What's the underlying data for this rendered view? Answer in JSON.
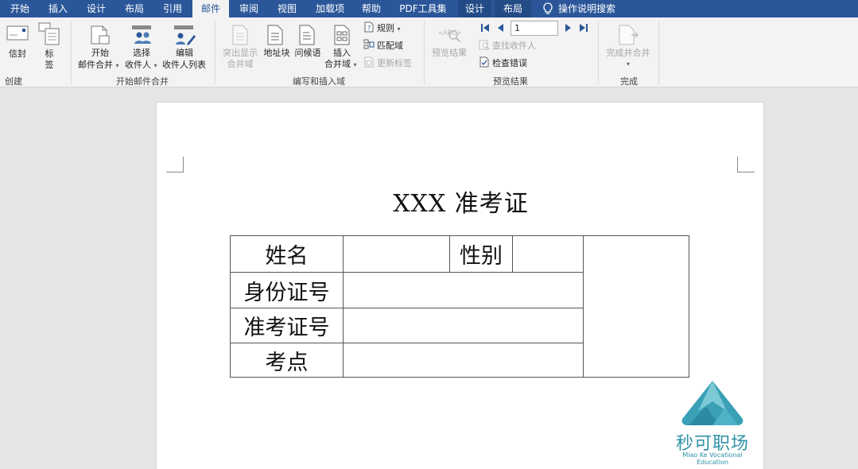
{
  "tabs": [
    {
      "label": "开始",
      "active": false
    },
    {
      "label": "插入",
      "active": false
    },
    {
      "label": "设计",
      "active": false
    },
    {
      "label": "布局",
      "active": false
    },
    {
      "label": "引用",
      "active": false
    },
    {
      "label": "邮件",
      "active": true
    },
    {
      "label": "审阅",
      "active": false
    },
    {
      "label": "视图",
      "active": false
    },
    {
      "label": "加载项",
      "active": false
    },
    {
      "label": "帮助",
      "active": false
    },
    {
      "label": "PDF工具集",
      "active": false
    },
    {
      "label": "设计",
      "active": false
    },
    {
      "label": "布局",
      "active": false
    }
  ],
  "tell_me": "操作说明搜索",
  "ribbon": {
    "create": {
      "envelope": "信封",
      "label_1": "标",
      "label_2": "签",
      "group": "创建"
    },
    "start_merge": {
      "start_1": "开始",
      "start_2": "邮件合并",
      "select_1": "选择",
      "select_2": "收件人",
      "edit_1": "编辑",
      "edit_2": "收件人列表",
      "group": "开始邮件合并"
    },
    "write_insert": {
      "highlight_1": "突出显示",
      "highlight_2": "合并域",
      "address_block": "地址块",
      "greeting": "问候语",
      "insert_1": "插入",
      "insert_2": "合并域",
      "rules": "规则",
      "match_fields": "匹配域",
      "update_labels": "更新标签",
      "group": "编写和插入域"
    },
    "preview": {
      "preview_results": "预览结果",
      "record": "1",
      "find_recipient": "查找收件人",
      "check_errors": "检查错误",
      "group": "预览结果"
    },
    "finish": {
      "finish_merge": "完成并合并",
      "group": "完成"
    }
  },
  "document": {
    "title": "XXX 准考证",
    "table": {
      "name_label": "姓名",
      "gender_label": "性别",
      "id_label": "身份证号",
      "ticket_label": "准考证号",
      "site_label": "考点"
    }
  },
  "watermark": {
    "name": "秒可职场",
    "subtitle": "Miao Ke Vocational Education"
  },
  "colors": {
    "tab_bar": "#2b579a",
    "ribbon": "#f3f3f3",
    "workspace": "#e6e6e6",
    "logo": "#2e93a7"
  }
}
